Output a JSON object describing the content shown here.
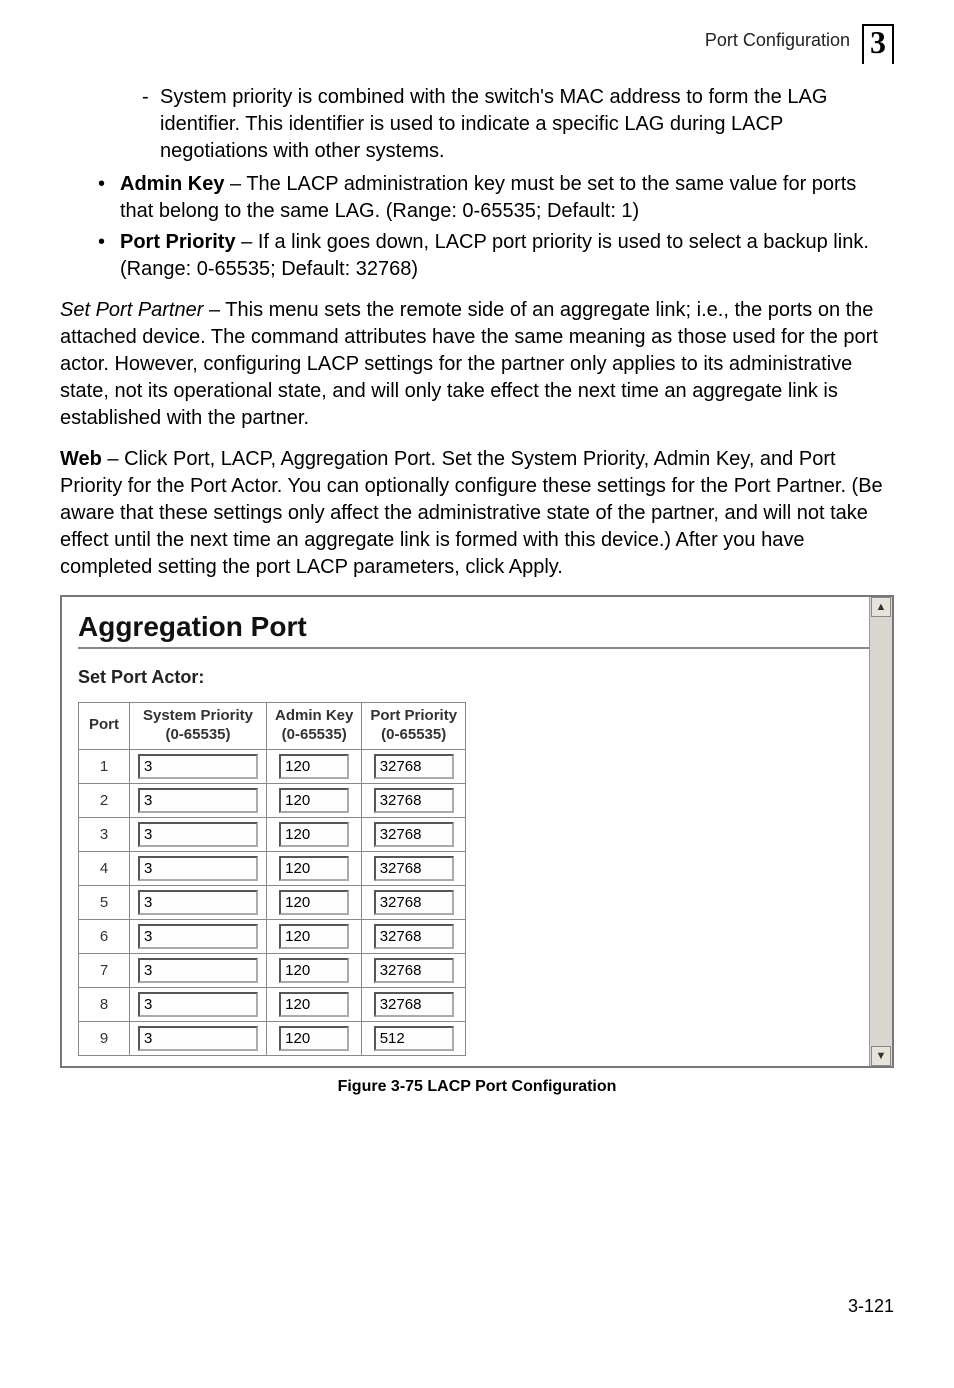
{
  "header": {
    "title": "Port Configuration",
    "chapter": "3"
  },
  "content": {
    "dash_item": "System priority is combined with the switch's MAC address to form the LAG identifier. This identifier is used to indicate a specific LAG during LACP negotiations with other systems.",
    "bullet_admin_label": "Admin Key",
    "bullet_admin_text": " – The LACP administration key must be set to the same value for ports that belong to the same LAG. (Range: 0-65535; Default: 1)",
    "bullet_pp_label": "Port Priority",
    "bullet_pp_text": " – If a link goes down, LACP port priority is used to select a backup link. (Range: 0-65535; Default: 32768)",
    "set_port_partner_em": "Set Port Partner",
    "set_port_partner_text": " – This menu sets the remote side of an aggregate link; i.e., the ports on the attached device. The command attributes have the same meaning as those used for the port actor. However, configuring LACP settings for the partner only applies to its administrative state, not its operational state, and will only take effect the next time an aggregate link is established with the partner.",
    "web_label": "Web",
    "web_text": " – Click Port, LACP, Aggregation Port. Set the System Priority, Admin Key, and Port Priority for the Port Actor. You can optionally configure these settings for the Port Partner. (Be aware that these settings only affect the administrative state of the partner, and will not take effect until the next time an aggregate link is formed with this device.) After you have completed setting the port LACP parameters, click Apply."
  },
  "panel": {
    "title": "Aggregation Port",
    "subhead": "Set Port Actor:",
    "columns": {
      "port": "Port",
      "sys": "System Priority",
      "sys_range": "(0-65535)",
      "admin": "Admin Key",
      "admin_range": "(0-65535)",
      "pp": "Port Priority",
      "pp_range": "(0-65535)"
    },
    "rows": [
      {
        "port": "1",
        "sys": "3",
        "admin": "120",
        "pp": "32768"
      },
      {
        "port": "2",
        "sys": "3",
        "admin": "120",
        "pp": "32768"
      },
      {
        "port": "3",
        "sys": "3",
        "admin": "120",
        "pp": "32768"
      },
      {
        "port": "4",
        "sys": "3",
        "admin": "120",
        "pp": "32768"
      },
      {
        "port": "5",
        "sys": "3",
        "admin": "120",
        "pp": "32768"
      },
      {
        "port": "6",
        "sys": "3",
        "admin": "120",
        "pp": "32768"
      },
      {
        "port": "7",
        "sys": "3",
        "admin": "120",
        "pp": "32768"
      },
      {
        "port": "8",
        "sys": "3",
        "admin": "120",
        "pp": "32768"
      },
      {
        "port": "9",
        "sys": "3",
        "admin": "120",
        "pp": "512"
      }
    ]
  },
  "figure": {
    "caption": "Figure 3-75  LACP Port Configuration"
  },
  "footer": {
    "page": "3-121"
  }
}
